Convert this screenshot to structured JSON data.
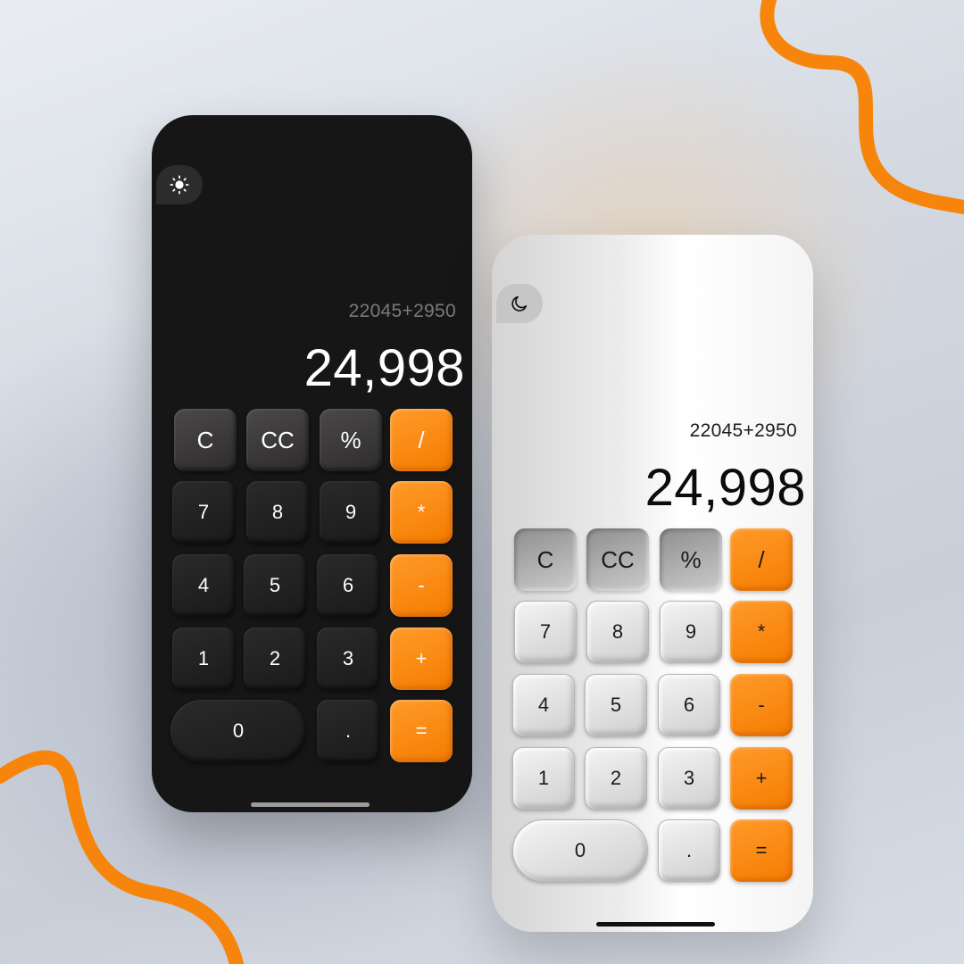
{
  "colors": {
    "accent": "#f7850b",
    "dark_bg": "#161616",
    "light_bg": "#f0f0f0"
  },
  "dark_phone": {
    "theme_toggle_icon": "sun-icon",
    "expression": "22045+2950",
    "result": "24,998"
  },
  "light_phone": {
    "theme_toggle_icon": "moon-icon",
    "expression": "22045+2950",
    "result": "24,998"
  },
  "keys": {
    "clear": "C",
    "clear_all": "CC",
    "percent": "%",
    "divide": "/",
    "seven": "7",
    "eight": "8",
    "nine": "9",
    "multiply": "*",
    "four": "4",
    "five": "5",
    "six": "6",
    "minus": "-",
    "one": "1",
    "two": "2",
    "three": "3",
    "plus": "+",
    "zero": "0",
    "decimal": ".",
    "equals": "="
  }
}
